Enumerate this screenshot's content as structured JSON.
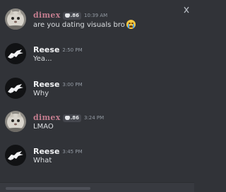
{
  "messages": [
    {
      "author": "dimex",
      "tag": ".86",
      "time": "10:39 AM",
      "text": "are you dating visuals bro",
      "emoji": "loudly-crying-face"
    },
    {
      "author": "Reese",
      "time": "2:50 PM",
      "text": "Yea..."
    },
    {
      "author": "Reese",
      "time": "3:00 PM",
      "text": "Why"
    },
    {
      "author": "dimex",
      "tag": ".86",
      "time": "3:24 PM",
      "text": "LMAO"
    },
    {
      "author": "Reese",
      "time": "3:45 PM",
      "text": "What"
    }
  ],
  "colors": {
    "background": "#313338",
    "dimex_name": "#c27c8e",
    "reese_name": "#f2f3f5",
    "message_text": "#dbdee1",
    "timestamp": "#949ba4"
  },
  "icons": {
    "dimex_avatar": "cat-avatar",
    "reese_avatar": "wolf-logo-avatar",
    "tag_icon": "clan-tag-icon",
    "corner": "close-icon"
  }
}
